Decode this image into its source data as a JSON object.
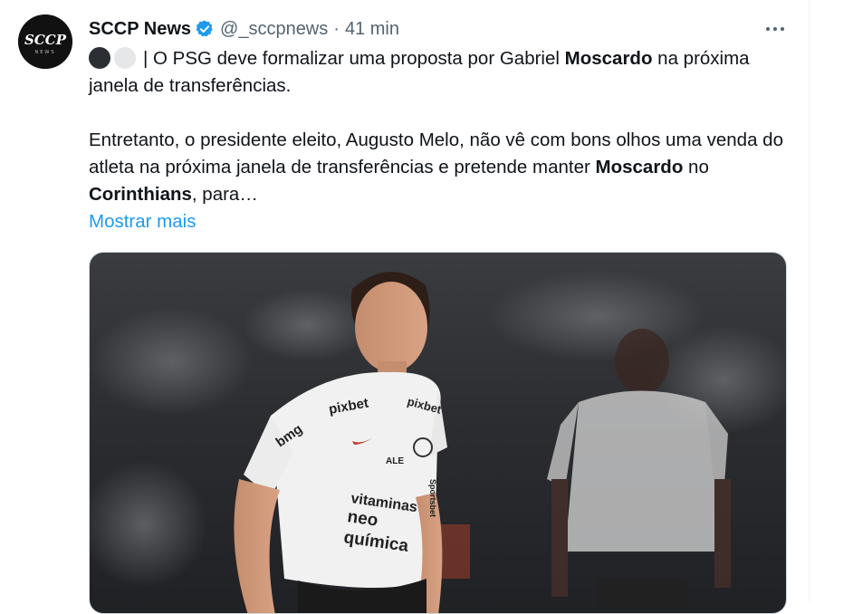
{
  "tweet": {
    "author_name": "SCCP News",
    "handle": "@_sccpnews",
    "separator": "·",
    "time": "41 min",
    "avatar_text": "SCCP",
    "avatar_subtext": "NEWS",
    "line1_prefix": "| O PSG deve formalizar uma proposta por Gabriel ",
    "line1_bold": "Moscardo",
    "line1_suffix": " na próxima janela de transferências.",
    "para2_text": "Entretanto, o presidente eleito, Augusto Melo, não vê com bons olhos uma venda do atleta na próxima janela de transferências e pretende manter ",
    "para2_bold1": "Moscardo",
    "para2_mid": " no ",
    "para2_bold2": "Corinthians",
    "para2_end": ", para…",
    "show_more": "Mostrar mais"
  },
  "media": {
    "jersey_sponsor_top": "pixbet",
    "jersey_sponsor_left": "bmg",
    "jersey_sponsor_right": "pixbet",
    "jersey_brand": "ALE",
    "jersey_chest_1": "vitaminas",
    "jersey_chest_2": "neo",
    "jersey_chest_3": "química",
    "jersey_side": "Sportsbet"
  },
  "colors": {
    "link": "#1d9bf0",
    "verified": "#1d9bf0",
    "secondary_text": "#536471"
  },
  "icons": [
    "verified-badge-icon",
    "more-options-icon"
  ]
}
